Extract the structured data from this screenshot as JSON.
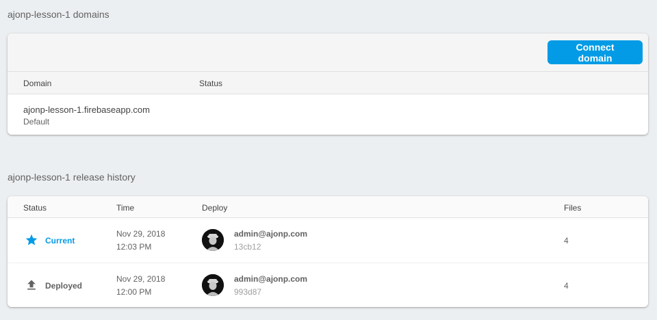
{
  "domains": {
    "title": "ajonp-lesson-1 domains",
    "connect_button_label": "Connect domain",
    "columns": [
      "Domain",
      "Status"
    ],
    "rows": [
      {
        "domain": "ajonp-lesson-1.firebaseapp.com",
        "note": "Default",
        "status": ""
      }
    ]
  },
  "release_history": {
    "title": "ajonp-lesson-1 release history",
    "columns": [
      "Status",
      "Time",
      "Deploy",
      "Files"
    ],
    "rows": [
      {
        "status": "Current",
        "status_icon": "star-icon",
        "date": "Nov 29, 2018",
        "time": "12:03 PM",
        "user": "admin@ajonp.com",
        "hash": "13cb12",
        "files": "4"
      },
      {
        "status": "Deployed",
        "status_icon": "upload-icon",
        "date": "Nov 29, 2018",
        "time": "12:00 PM",
        "user": "admin@ajonp.com",
        "hash": "993d87",
        "files": "4"
      }
    ]
  },
  "colors": {
    "accent": "#039be5",
    "background": "#eceff1"
  }
}
